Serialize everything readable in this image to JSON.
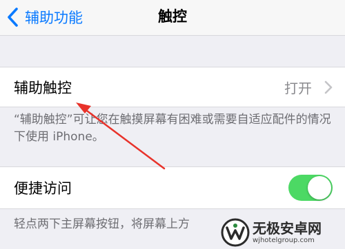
{
  "navbar": {
    "back_label": "辅助功能",
    "back_icon": "chevron-left-icon",
    "title": "触控"
  },
  "assistive_touch": {
    "label": "辅助触控",
    "value": "打开",
    "description": "“辅助触控”可让您在触摸屏幕有困难或需要自适应配件的情况下使用 iPhone。"
  },
  "reachability": {
    "label": "便捷访问",
    "toggle_on": true,
    "description": "轻点两下主屏幕按钮，将屏幕上方"
  },
  "watermark": {
    "title": "无极安卓网",
    "url": "wjhotelgroup.com"
  },
  "colors": {
    "accent": "#0a7aff",
    "toggle_on": "#4cd964",
    "annotation": "#e8322a",
    "background": "#efeff4"
  }
}
